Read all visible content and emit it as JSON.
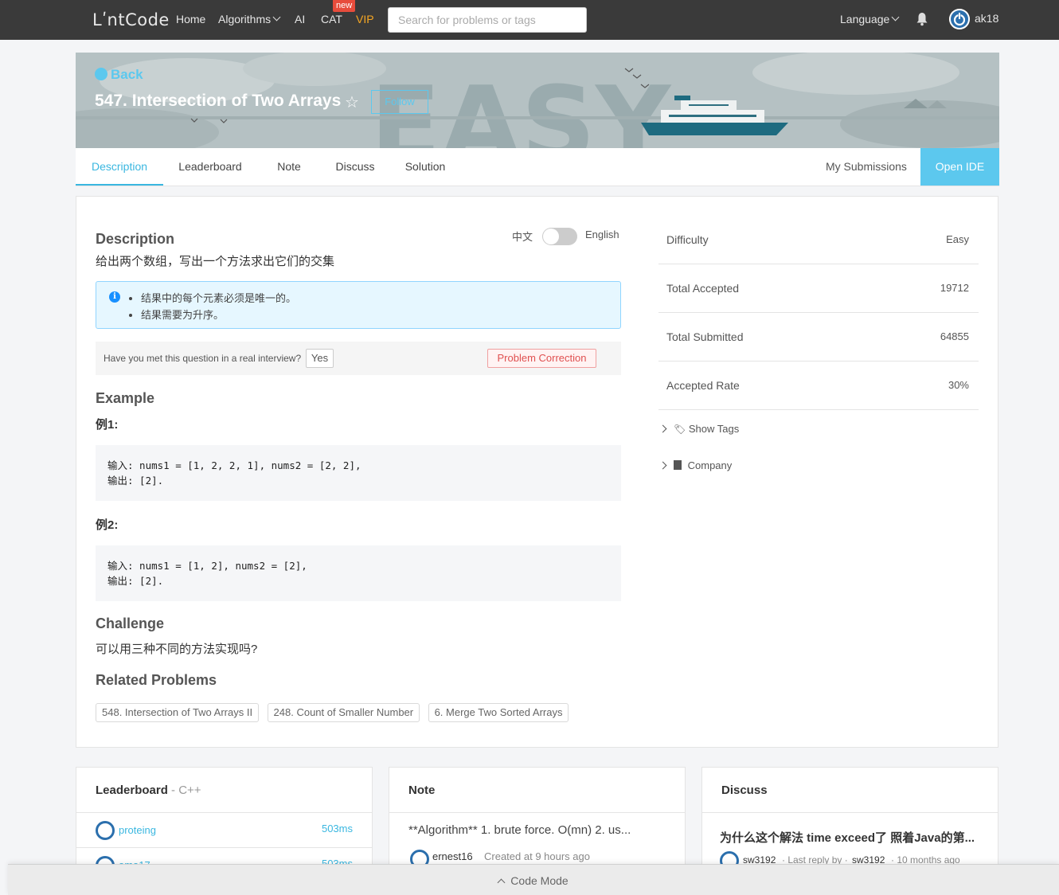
{
  "nav": {
    "logo": "LʹntCode",
    "home": "Home",
    "algorithms": "Algorithms",
    "ai": "AI",
    "cat": "CAT",
    "new_badge": "new",
    "vip": "VIP",
    "search_placeholder": "Search for problems or tags",
    "language": "Language",
    "username": "ak18"
  },
  "banner": {
    "back": "Back",
    "title": "547. Intersection of Two Arrays",
    "follow": "Follow",
    "difficulty_watermark": "EASY"
  },
  "tabs": {
    "items": [
      "Description",
      "Leaderboard",
      "Note",
      "Discuss",
      "Solution"
    ],
    "active": "Description",
    "my_submissions": "My Submissions",
    "open_ide": "Open IDE"
  },
  "description": {
    "heading": "Description",
    "lang_zh": "中文",
    "lang_en": "English",
    "text": "给出两个数组，写出一个方法求出它们的交集",
    "notes": [
      "结果中的每个元素必须是唯一的。",
      "结果需要为升序。"
    ],
    "interview_question": "Have you met this question in a real interview?",
    "yes": "Yes",
    "problem_correction": "Problem Correction"
  },
  "example": {
    "heading": "Example",
    "ex1_label": "例1:",
    "ex1_lines": [
      "输入: nums1 = [1, 2, 2, 1], nums2 = [2, 2],",
      "输出: [2]."
    ],
    "ex2_label": "例2:",
    "ex2_lines": [
      "输入: nums1 = [1, 2], nums2 = [2],",
      "输出: [2]."
    ]
  },
  "challenge": {
    "heading": "Challenge",
    "text": "可以用三种不同的方法实现吗?"
  },
  "related": {
    "heading": "Related Problems",
    "items": [
      "548. Intersection of Two Arrays II",
      "248. Count of Smaller Number",
      "6. Merge Two Sorted Arrays"
    ]
  },
  "stats": {
    "rows": [
      {
        "label": "Difficulty",
        "value": "Easy"
      },
      {
        "label": "Total Accepted",
        "value": "19712"
      },
      {
        "label": "Total Submitted",
        "value": "64855"
      },
      {
        "label": "Accepted Rate",
        "value": "30%"
      }
    ],
    "show_tags": "Show Tags",
    "company": "Company"
  },
  "leaderboard_card": {
    "title": "Leaderboard",
    "lang": " - C++",
    "rows": [
      {
        "name": "proteing",
        "time": "503ms"
      },
      {
        "name": "ama17",
        "time": "503ms"
      }
    ]
  },
  "note_card": {
    "title": "Note",
    "snippet": "**Algorithm** 1. brute force. O(mn) 2. us...",
    "author": "ernest16",
    "meta": "Created at 9 hours ago"
  },
  "discuss_card": {
    "title": "Discuss",
    "snippet": "为什么这个解法 time exceed了 照着Java的第...",
    "author": "sw3192",
    "meta_prefix": "· Last reply by ·",
    "meta_author": "sw3192",
    "meta_suffix": "· 10 months ago"
  },
  "code_mode": "Code Mode",
  "colors": {
    "accent": "#5cc8ee",
    "nav_bg": "#3a3a3a",
    "vip": "#f5a623",
    "badge": "#e74c3c"
  }
}
